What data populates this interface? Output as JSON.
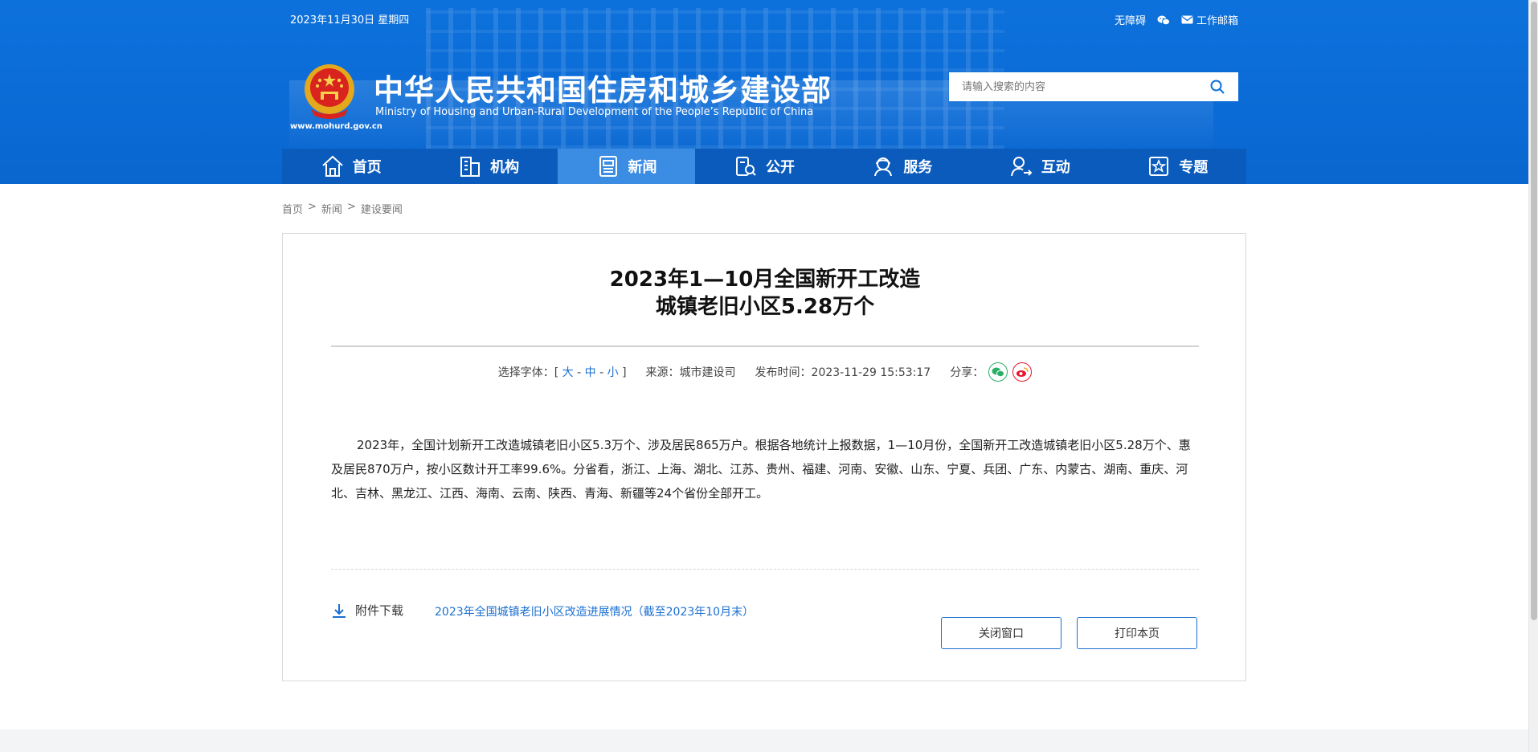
{
  "header": {
    "date": "2023年11月30日 星期四",
    "accessibility": "无障碍",
    "email": "工作邮箱",
    "site_name_cn": "中华人民共和国住房和城乡建设部",
    "site_name_en": "Ministry of Housing and Urban-Rural Development of the People’s Republic of China",
    "site_url": "www.mohurd.gov.cn",
    "search_placeholder": "请输入搜索的内容"
  },
  "nav": {
    "items": [
      {
        "label": "首页",
        "icon": "home-icon"
      },
      {
        "label": "机构",
        "icon": "building-icon"
      },
      {
        "label": "新闻",
        "icon": "news-icon",
        "active": true
      },
      {
        "label": "公开",
        "icon": "open-info-icon"
      },
      {
        "label": "服务",
        "icon": "service-icon"
      },
      {
        "label": "互动",
        "icon": "interaction-icon"
      },
      {
        "label": "专题",
        "icon": "topic-icon"
      }
    ]
  },
  "breadcrumb": {
    "home": "首页",
    "sep": ">",
    "section": "新闻",
    "current": "建设要闻"
  },
  "article": {
    "title_line1": "2023年1—10月全国新开工改造",
    "title_line2": "城镇老旧小区5.28万个",
    "font_label": "选择字体：[",
    "font_large": "大",
    "font_mid": "中",
    "font_small": "小",
    "font_dash": "-",
    "font_close": "]",
    "source": "来源：城市建设司",
    "publish_time": "发布时间：2023-11-29 15:53:17",
    "share_label": "分享：",
    "body": "2023年，全国计划新开工改造城镇老旧小区5.3万个、涉及居民865万户。根据各地统计上报数据，1—10月份，全国新开工改造城镇老旧小区5.28万个、惠及居民870万户，按小区数计开工率99.6%。分省看，浙江、上海、湖北、江苏、贵州、福建、河南、安徽、山东、宁夏、兵团、广东、内蒙古、湖南、重庆、河北、吉林、黑龙江、江西、海南、云南、陕西、青海、新疆等24个省份全部开工。",
    "attachment_label": "附件下载",
    "attachment_link": "2023年全国城镇老旧小区改造进展情况（截至2023年10月末）",
    "close_button": "关闭窗口",
    "print_button": "打印本页"
  },
  "colors": {
    "header_blue": "#0d71dc",
    "nav_blue": "#0b5bbd",
    "nav_active": "#3a8de3",
    "link_blue": "#1a6fd1",
    "wechat_green": "#2aae67",
    "weibo_red": "#e6162d"
  }
}
